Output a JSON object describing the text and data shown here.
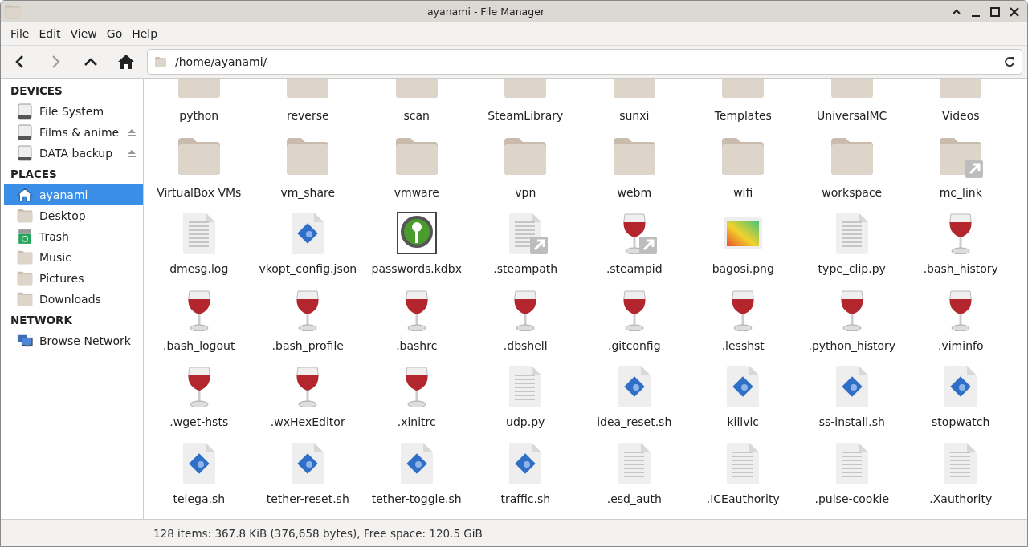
{
  "window": {
    "title": "ayanami - File Manager"
  },
  "menu": [
    "File",
    "Edit",
    "View",
    "Go",
    "Help"
  ],
  "location": {
    "value": "/home/ayanami/"
  },
  "sidebar": [
    {
      "heading": "DEVICES",
      "items": [
        {
          "label": "File System",
          "kind": "drive",
          "ejectable": false,
          "selected": false
        },
        {
          "label": "Films & anime",
          "kind": "drive",
          "ejectable": true,
          "selected": false
        },
        {
          "label": "DATA backup",
          "kind": "drive",
          "ejectable": true,
          "selected": false
        }
      ]
    },
    {
      "heading": "PLACES",
      "items": [
        {
          "label": "ayanami",
          "kind": "home",
          "ejectable": false,
          "selected": true
        },
        {
          "label": "Desktop",
          "kind": "desktop",
          "ejectable": false,
          "selected": false
        },
        {
          "label": "Trash",
          "kind": "trash",
          "ejectable": false,
          "selected": false
        },
        {
          "label": "Music",
          "kind": "music",
          "ejectable": false,
          "selected": false
        },
        {
          "label": "Pictures",
          "kind": "pictures",
          "ejectable": false,
          "selected": false
        },
        {
          "label": "Downloads",
          "kind": "downloads",
          "ejectable": false,
          "selected": false
        }
      ]
    },
    {
      "heading": "NETWORK",
      "items": [
        {
          "label": "Browse Network",
          "kind": "network",
          "ejectable": false,
          "selected": false
        }
      ]
    }
  ],
  "files": [
    {
      "name": "python",
      "kind": "folder"
    },
    {
      "name": "reverse",
      "kind": "folder"
    },
    {
      "name": "scan",
      "kind": "folder"
    },
    {
      "name": "SteamLibrary",
      "kind": "folder"
    },
    {
      "name": "sunxi",
      "kind": "folder"
    },
    {
      "name": "Templates",
      "kind": "folder"
    },
    {
      "name": "UniversalMC",
      "kind": "folder"
    },
    {
      "name": "Videos",
      "kind": "folder"
    },
    {
      "name": "VirtualBox VMs",
      "kind": "folder"
    },
    {
      "name": "vm_share",
      "kind": "folder"
    },
    {
      "name": "vmware",
      "kind": "folder"
    },
    {
      "name": "vpn",
      "kind": "folder"
    },
    {
      "name": "webm",
      "kind": "folder"
    },
    {
      "name": "wifi",
      "kind": "folder"
    },
    {
      "name": "workspace",
      "kind": "folder"
    },
    {
      "name": "mc_link",
      "kind": "folder_link"
    },
    {
      "name": "dmesg.log",
      "kind": "text"
    },
    {
      "name": "vkopt_config.json",
      "kind": "script"
    },
    {
      "name": "passwords.kdbx",
      "kind": "keepass"
    },
    {
      "name": ".steampath",
      "kind": "text_link"
    },
    {
      "name": ".steampid",
      "kind": "wine_link"
    },
    {
      "name": "bagosi.png",
      "kind": "image"
    },
    {
      "name": "type_clip.py",
      "kind": "text"
    },
    {
      "name": ".bash_history",
      "kind": "wine"
    },
    {
      "name": ".bash_logout",
      "kind": "wine"
    },
    {
      "name": ".bash_profile",
      "kind": "wine"
    },
    {
      "name": ".bashrc",
      "kind": "wine"
    },
    {
      "name": ".dbshell",
      "kind": "wine"
    },
    {
      "name": ".gitconfig",
      "kind": "wine"
    },
    {
      "name": ".lesshst",
      "kind": "wine"
    },
    {
      "name": ".python_history",
      "kind": "wine"
    },
    {
      "name": ".viminfo",
      "kind": "wine"
    },
    {
      "name": ".wget-hsts",
      "kind": "wine"
    },
    {
      "name": ".wxHexEditor",
      "kind": "wine"
    },
    {
      "name": ".xinitrc",
      "kind": "wine"
    },
    {
      "name": "udp.py",
      "kind": "text"
    },
    {
      "name": "idea_reset.sh",
      "kind": "script"
    },
    {
      "name": "killvlc",
      "kind": "script"
    },
    {
      "name": "ss-install.sh",
      "kind": "script"
    },
    {
      "name": "stopwatch",
      "kind": "script"
    },
    {
      "name": "telega.sh",
      "kind": "script"
    },
    {
      "name": "tether-reset.sh",
      "kind": "script"
    },
    {
      "name": "tether-toggle.sh",
      "kind": "script"
    },
    {
      "name": "traffic.sh",
      "kind": "script"
    },
    {
      "name": ".esd_auth",
      "kind": "text"
    },
    {
      "name": ".ICEauthority",
      "kind": "text"
    },
    {
      "name": ".pulse-cookie",
      "kind": "text"
    },
    {
      "name": ".Xauthority",
      "kind": "text"
    }
  ],
  "status_bar": "128 items: 367.8 KiB (376,658 bytes), Free space: 120.5 GiB"
}
